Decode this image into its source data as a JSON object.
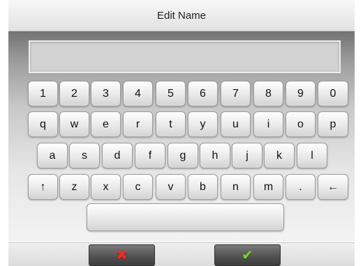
{
  "header": {
    "title": "Edit Name"
  },
  "input": {
    "value": ""
  },
  "keyboard": {
    "row1": [
      "1",
      "2",
      "3",
      "4",
      "5",
      "6",
      "7",
      "8",
      "9",
      "0"
    ],
    "row2": [
      "q",
      "w",
      "e",
      "r",
      "t",
      "y",
      "u",
      "i",
      "o",
      "p"
    ],
    "row3": [
      "a",
      "s",
      "d",
      "f",
      "g",
      "h",
      "j",
      "k",
      "l"
    ],
    "row4": [
      "↑",
      "z",
      "x",
      "c",
      "v",
      "b",
      "n",
      "m",
      ".",
      "←"
    ],
    "space": ""
  },
  "actions": {
    "cancel": {
      "glyph": "✖",
      "icon": "cancel-x-icon",
      "color": "#e0302a"
    },
    "confirm": {
      "glyph": "✔",
      "icon": "checkmark-icon",
      "color": "#7cd235"
    }
  }
}
